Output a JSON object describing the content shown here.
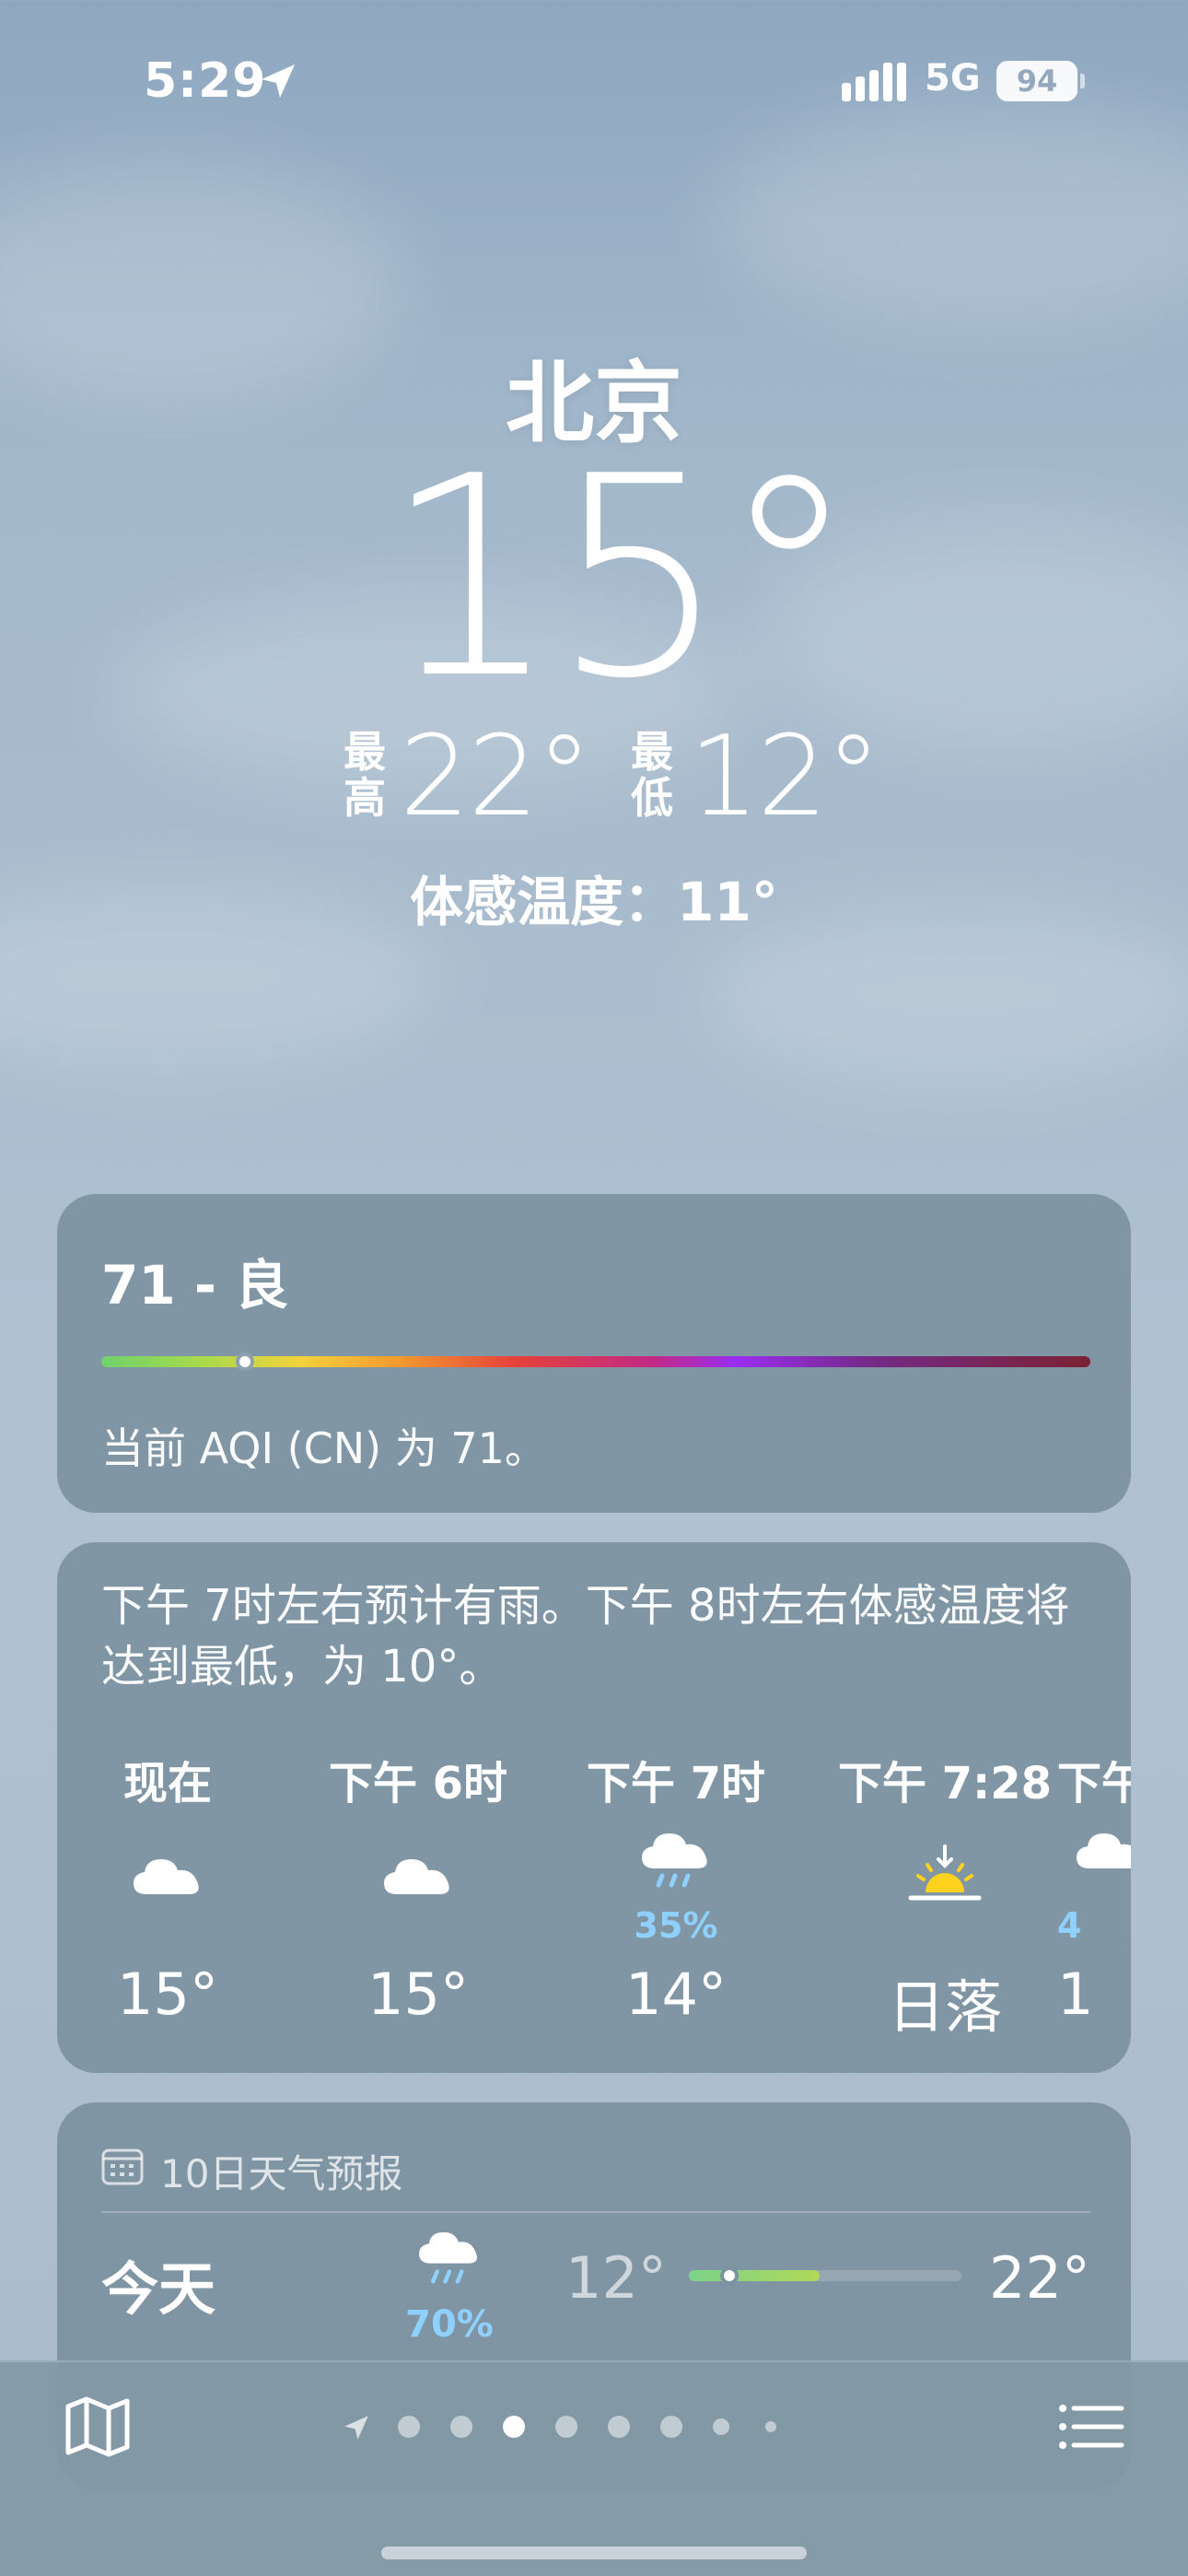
{
  "status_bar": {
    "time": "5:29",
    "network": "5G",
    "battery": "94"
  },
  "header": {
    "city": "北京",
    "temperature": "15°",
    "high_label": "最\n高",
    "high_label_top": "最",
    "high_label_bottom": "高",
    "high_value": "22°",
    "low_label_top": "最",
    "low_label_bottom": "低",
    "low_value": "12°",
    "feels_like": "体感温度：11°"
  },
  "aqi_card": {
    "title": "71 - 良",
    "description": "当前 AQI (CN) 为 71。",
    "value": 71,
    "indicator_fraction": 0.145
  },
  "hourly_card": {
    "summary": "下午 7时左右预计有雨。下午 8时左右体感温度将达到最低，为 10°。",
    "hours": [
      {
        "label": "现在",
        "icon": "cloud-icon",
        "precip": "",
        "temp": "15°"
      },
      {
        "label": "下午 6时",
        "icon": "cloud-icon",
        "precip": "",
        "temp": "15°"
      },
      {
        "label": "下午 7时",
        "icon": "rain-cloud-icon",
        "precip": "35%",
        "temp": "14°"
      },
      {
        "label": "下午 7:28",
        "icon": "sunset-icon",
        "precip": "",
        "temp": "日落"
      },
      {
        "label": "下午",
        "icon": "rain-cloud-icon",
        "precip": "4",
        "temp": "1"
      }
    ]
  },
  "daily_card": {
    "title": "10日天气预报",
    "days": [
      {
        "name": "今天",
        "icon": "rain-cloud-icon",
        "precip": "70%",
        "low": "12°",
        "high": "22°",
        "range_start": 0.0,
        "range_end": 0.48,
        "current_fraction": 0.15
      }
    ]
  },
  "bottom_bar": {
    "page_count": 8,
    "active_page": 3
  },
  "colors": {
    "precip_blue": "#8ed1ff",
    "card_bg": "#768c9a"
  }
}
